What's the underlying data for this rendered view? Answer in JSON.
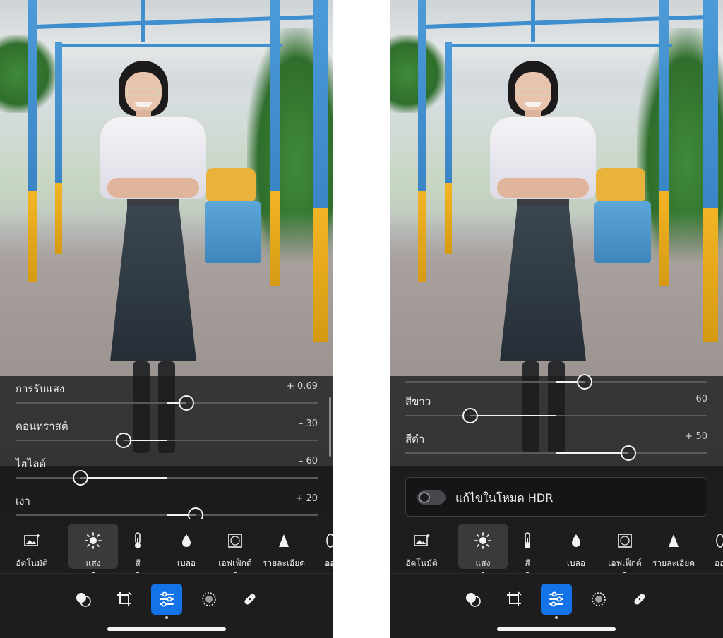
{
  "left_panel": {
    "sliders": [
      {
        "label": "การรับแสง",
        "value": "+ 0.69",
        "level": 0.69
      },
      {
        "label": "คอนทราสต์",
        "value": "– 30",
        "level": -30
      },
      {
        "label": "ไฮไลต์",
        "value": "– 60",
        "level": -60
      },
      {
        "label": "เงา",
        "value": "+ 20",
        "level": 20
      }
    ]
  },
  "right_panel": {
    "sliders": [
      {
        "label": "สีขาว",
        "value": "– 60",
        "level": -60
      },
      {
        "label": "สีดำ",
        "value": "+ 50",
        "level": 50
      }
    ],
    "hdr_toggle": {
      "label": "แก้ไขในโหมด HDR",
      "on": false
    }
  },
  "tools": [
    {
      "label": "อัตโนมัติ",
      "icon": "auto-photo-icon"
    },
    {
      "label": "แสง",
      "icon": "sun-icon",
      "active": true
    },
    {
      "label": "สี",
      "icon": "thermometer-icon"
    },
    {
      "label": "เบลอ",
      "icon": "droplet-icon"
    },
    {
      "label": "เอฟเฟ็กต์",
      "icon": "vignette-icon"
    },
    {
      "label": "รายละเอียด",
      "icon": "triangle-icon"
    },
    {
      "label": "ออป",
      "icon": "optics-icon"
    }
  ],
  "bottom_nav": [
    {
      "name": "presets",
      "icon": "presets-icon"
    },
    {
      "name": "crop",
      "icon": "crop-icon"
    },
    {
      "name": "edit",
      "icon": "sliders-icon",
      "active": true
    },
    {
      "name": "masking",
      "icon": "masking-icon"
    },
    {
      "name": "healing",
      "icon": "bandage-icon"
    }
  ],
  "colors": {
    "accent": "#1473e6",
    "background": "#1d1d1f",
    "active_tool": "#3a3a3d"
  }
}
